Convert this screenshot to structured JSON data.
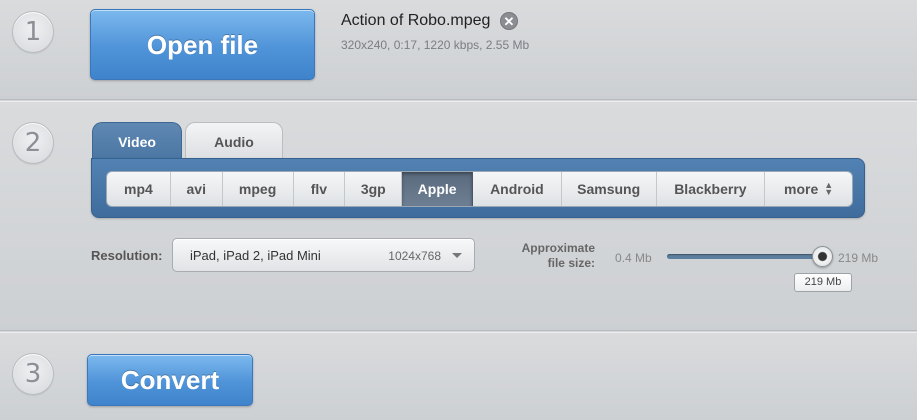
{
  "steps": [
    "1",
    "2",
    "3"
  ],
  "open_file": {
    "label": "Open file"
  },
  "file": {
    "name": "Action of Robo.mpeg",
    "remove_icon": "close-circle-icon",
    "info": "320x240, 0:17, 1220 kbps, 2.55 Mb"
  },
  "tabs": [
    {
      "label": "Video",
      "active": true
    },
    {
      "label": "Audio",
      "active": false
    }
  ],
  "formats": [
    {
      "label": "mp4",
      "active": false
    },
    {
      "label": "avi",
      "active": false
    },
    {
      "label": "mpeg",
      "active": false
    },
    {
      "label": "flv",
      "active": false
    },
    {
      "label": "3gp",
      "active": false
    },
    {
      "label": "Apple",
      "active": true
    },
    {
      "label": "Android",
      "active": false
    },
    {
      "label": "Samsung",
      "active": false
    },
    {
      "label": "Blackberry",
      "active": false
    },
    {
      "label": "more",
      "active": false
    }
  ],
  "resolution": {
    "label": "Resolution:",
    "value": "iPad, iPad 2, iPad Mini",
    "dims": "1024x768"
  },
  "file_size": {
    "label_line1": "Approximate",
    "label_line2": "file size:",
    "min": "0.4 Mb",
    "max": "219 Mb",
    "tooltip": "219 Mb",
    "level": 1.0
  },
  "convert": {
    "label": "Convert"
  },
  "colors": {
    "accent_blue": "#4f93d8",
    "panel_blue": "#4b76a3",
    "active_format": "#5a6a7d"
  }
}
